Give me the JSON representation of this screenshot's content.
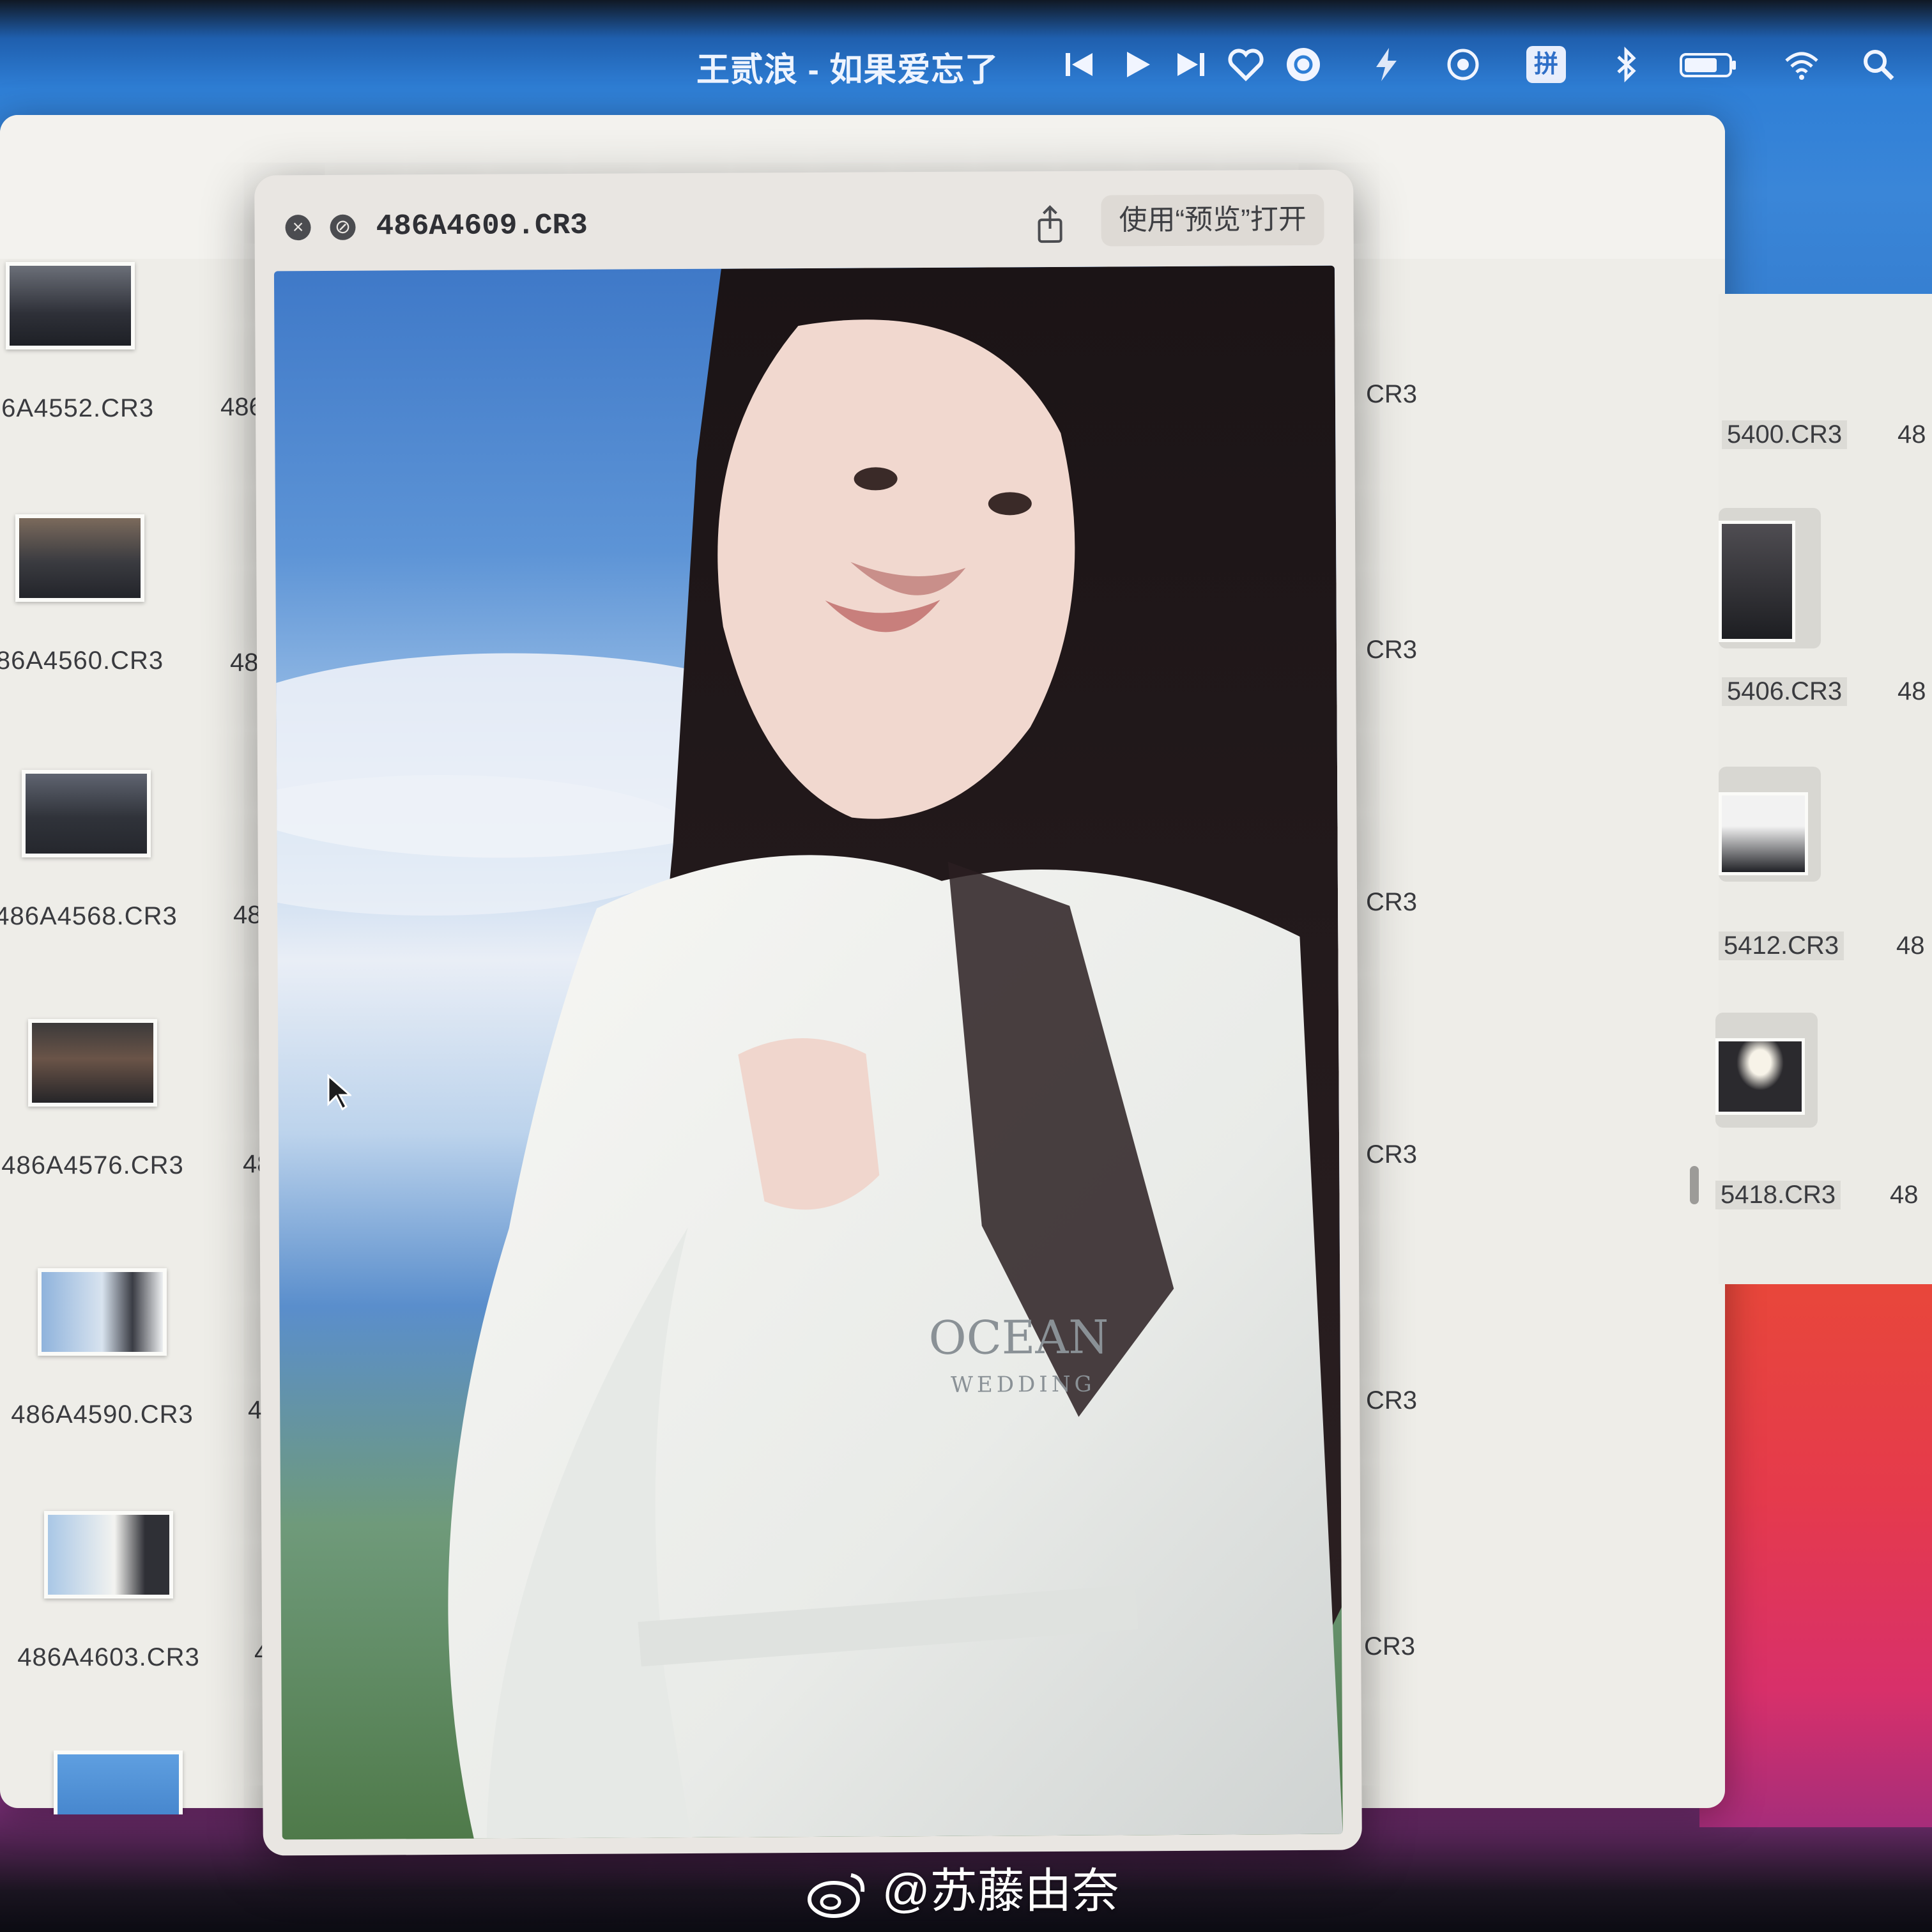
{
  "menubar": {
    "now_playing": "王贰浪 - 如果爱忘了",
    "ime_label": "拼"
  },
  "quicklook": {
    "filename": "486A4609.CR3",
    "open_button": "使用“预览”打开"
  },
  "finder": {
    "left_files": [
      "86A4552.CR3",
      "86A4560.CR3",
      "486A4568.CR3",
      "486A4576.CR3",
      "486A4590.CR3",
      "486A4603.CR3"
    ],
    "left_fragment": "486",
    "middle_fragment": "CR3",
    "right_files": [
      "5400.CR3",
      "5406.CR3",
      "5412.CR3",
      "5418.CR3"
    ],
    "right_fragment": "48"
  },
  "photo_text": {
    "line1": "OCEAN",
    "line2": "WEDDING"
  },
  "watermark": "@苏藤由奈"
}
